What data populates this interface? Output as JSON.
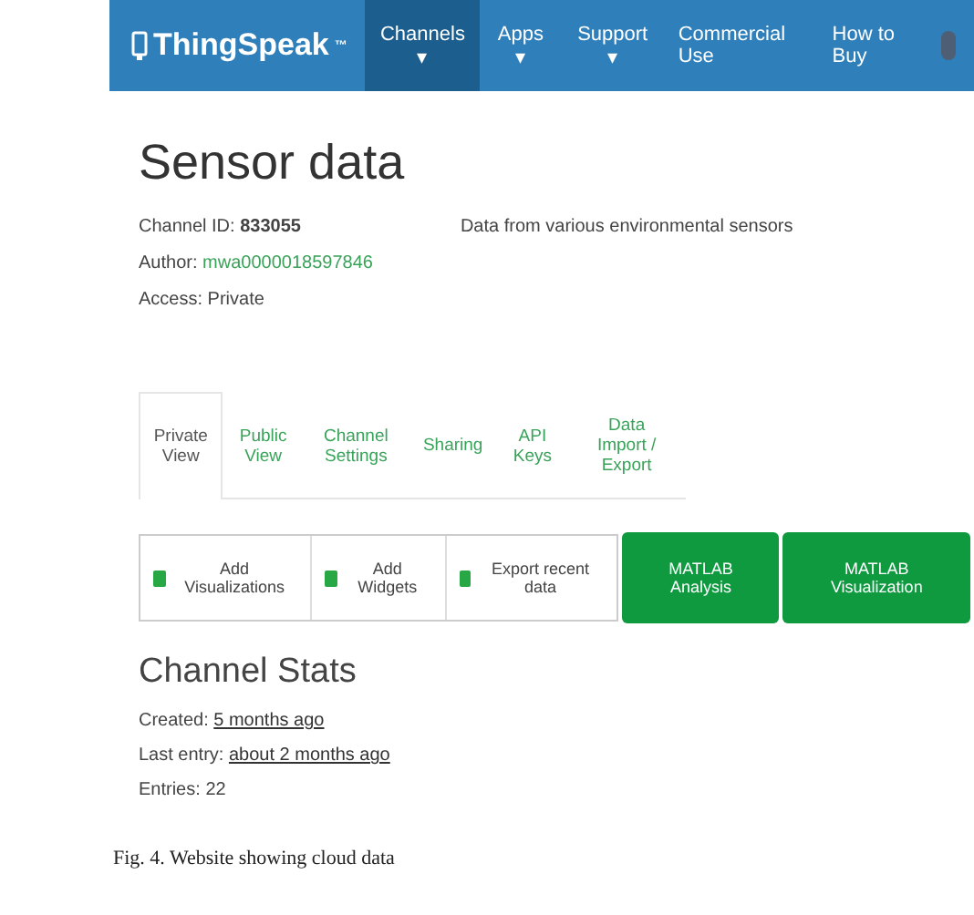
{
  "navbar": {
    "logo": "ThingSpeak",
    "logo_mark": "™",
    "menus": [
      {
        "label": "Channels ▾",
        "selected": true
      },
      {
        "label": "Apps ▾",
        "selected": false
      },
      {
        "label": "Support ▾",
        "selected": false
      }
    ],
    "right_links": [
      "Commercial Use",
      "How to Buy"
    ]
  },
  "channel": {
    "title": "Sensor data",
    "fields": [
      {
        "label": "Channel ID:",
        "value": "833055",
        "kind": "bold"
      },
      {
        "label": "Author:",
        "value": "mwa0000018597846",
        "kind": "link"
      },
      {
        "label": "Access:",
        "value": "Private",
        "kind": "plain"
      }
    ],
    "description": "Data from various environmental sensors"
  },
  "tabs": [
    {
      "label": "Private View",
      "selected": true
    },
    {
      "label": "Public View",
      "selected": false
    },
    {
      "label": "Channel Settings",
      "selected": false
    },
    {
      "label": "Sharing",
      "selected": false
    },
    {
      "label": "API Keys",
      "selected": false
    },
    {
      "label": "Data Import / Export",
      "selected": false
    }
  ],
  "actions": [
    "Add Visualizations",
    "Add Widgets",
    "Export recent data"
  ],
  "matlab_buttons": [
    "MATLAB Analysis",
    "MATLAB Visualization"
  ],
  "stats": {
    "title": "Channel Stats",
    "items": [
      {
        "label": "Created:",
        "value": "5 months ago",
        "kind": "link"
      },
      {
        "label": "Last entry:",
        "value": "about 2 months ago",
        "kind": "link"
      },
      {
        "label": "Entries:",
        "value": "22",
        "kind": "plain"
      }
    ]
  },
  "caption": "Fig. 4. Website showing cloud data"
}
